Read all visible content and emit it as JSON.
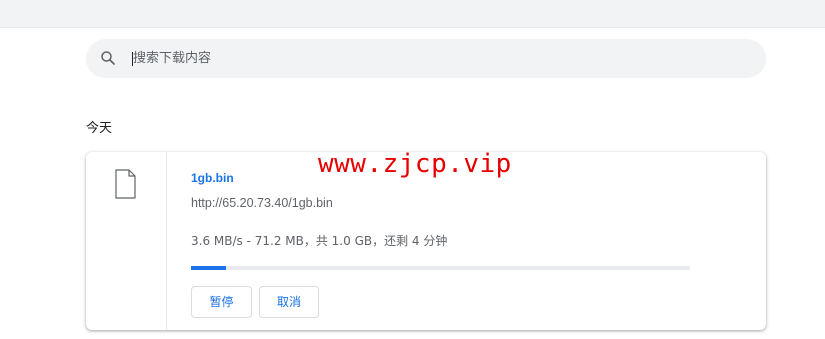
{
  "search": {
    "placeholder": "搜索下载内容",
    "icon": "search-icon"
  },
  "section": {
    "label": "今天"
  },
  "download": {
    "file_icon": "file-icon",
    "file_name": "1gb.bin",
    "url": "http://65.20.73.40/1gb.bin",
    "status": "3.6 MB/s - 71.2 MB，共 1.0 GB，还剩 4 分钟",
    "progress_fraction": 0.0695,
    "pause_label": "暂停",
    "cancel_label": "取消"
  },
  "watermark": {
    "text": "www.zjcp.vip"
  },
  "colors": {
    "accent": "#1a73e8",
    "watermark": "#e60000",
    "track": "#e8eaed"
  }
}
